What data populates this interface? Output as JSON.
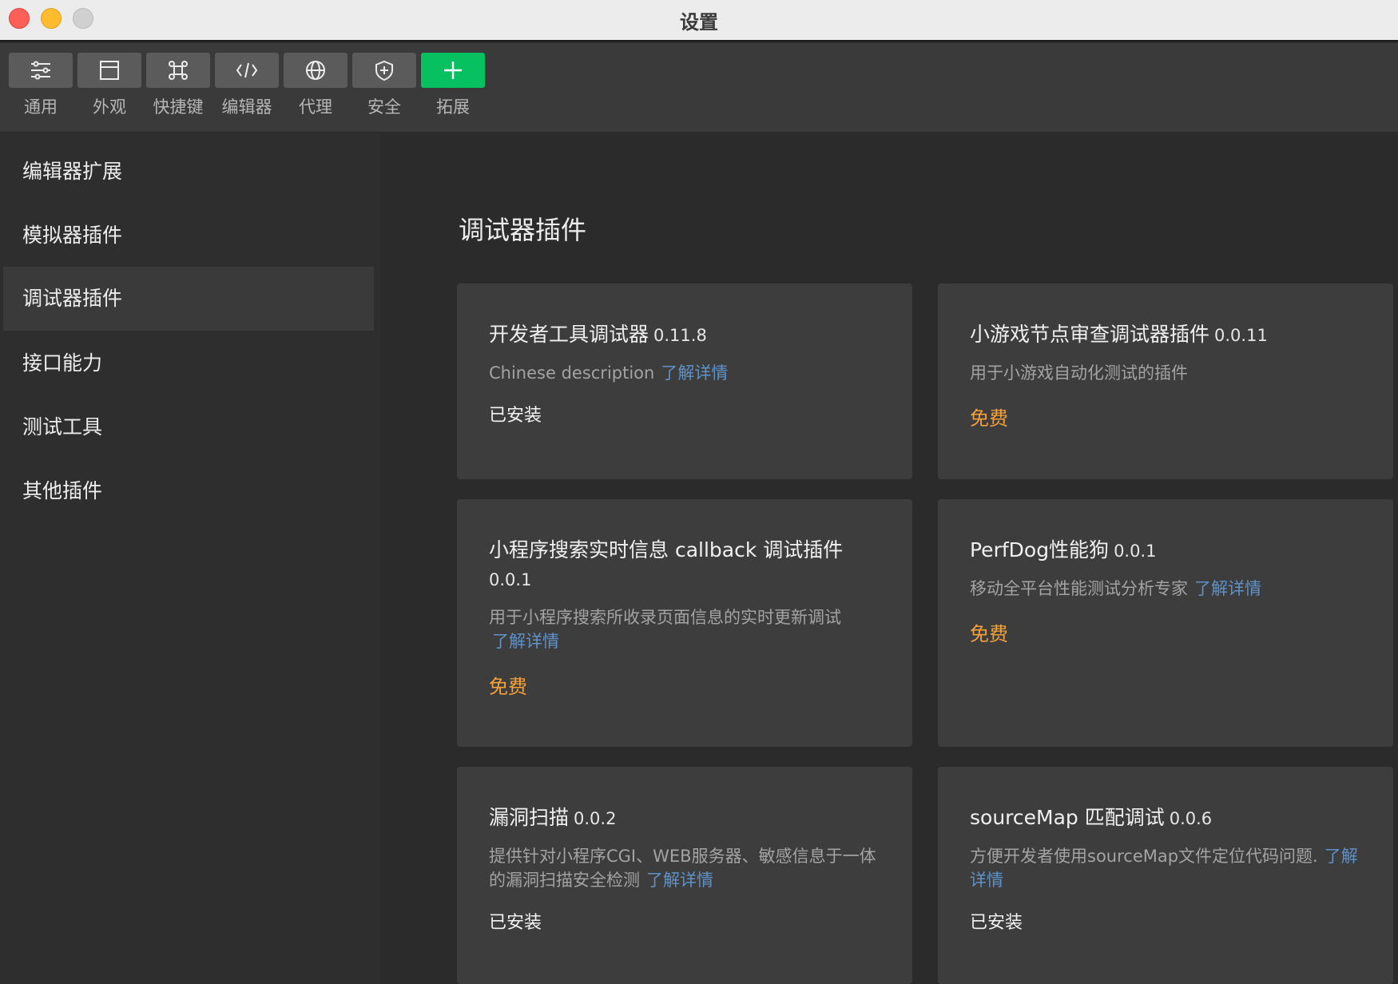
{
  "window": {
    "title": "设置"
  },
  "toolbar": {
    "items": [
      {
        "label": "通用",
        "icon": "sliders-icon"
      },
      {
        "label": "外观",
        "icon": "window-icon"
      },
      {
        "label": "快捷键",
        "icon": "command-icon"
      },
      {
        "label": "编辑器",
        "icon": "code-icon"
      },
      {
        "label": "代理",
        "icon": "globe-icon"
      },
      {
        "label": "安全",
        "icon": "shield-icon"
      },
      {
        "label": "拓展",
        "icon": "plus-icon",
        "active": true
      }
    ]
  },
  "sidebar": {
    "items": [
      {
        "label": "编辑器扩展"
      },
      {
        "label": "模拟器插件"
      },
      {
        "label": "调试器插件",
        "active": true
      },
      {
        "label": "接口能力"
      },
      {
        "label": "测试工具"
      },
      {
        "label": "其他插件"
      }
    ]
  },
  "main": {
    "title": "调试器插件",
    "cards": [
      {
        "name": "开发者工具调试器",
        "version": "0.11.8",
        "desc": "Chinese description",
        "more": "了解详情",
        "status": "已安装"
      },
      {
        "name": "小游戏节点审查调试器插件",
        "version": "0.0.11",
        "desc": "用于小游戏自动化测试的插件",
        "more": "",
        "status": "免费"
      },
      {
        "name": "小程序搜索实时信息 callback 调试插件",
        "version": "0.0.1",
        "desc": "用于小程序搜索所收录页面信息的实时更新调试",
        "more": "了解详情",
        "status": "免费"
      },
      {
        "name": "PerfDog性能狗",
        "version": "0.0.1",
        "desc": "移动全平台性能测试分析专家",
        "more": "了解详情",
        "status": "免费"
      },
      {
        "name": "漏洞扫描",
        "version": "0.0.2",
        "desc": "提供针对小程序CGI、WEB服务器、敏感信息于一体的漏洞扫描安全检测",
        "more": "了解详情",
        "status": "已安装"
      },
      {
        "name": "sourceMap 匹配调试",
        "version": "0.0.6",
        "desc": "方便开发者使用sourceMap文件定位代码问题.",
        "more": "了解详情",
        "status": "已安装"
      }
    ]
  },
  "colors": {
    "accent": "#07c160",
    "free": "#f4a13a",
    "link": "#5e92c9"
  }
}
